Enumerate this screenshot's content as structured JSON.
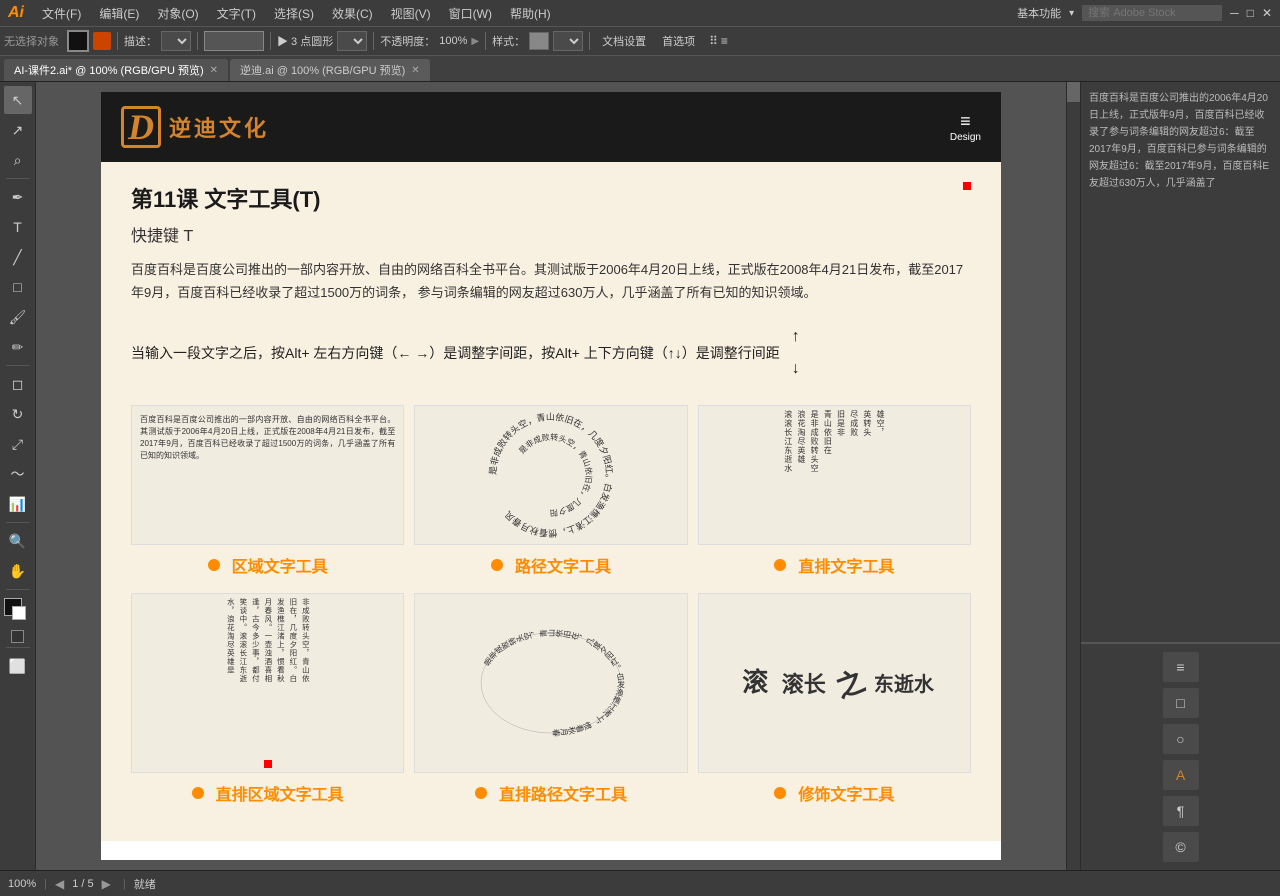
{
  "app": {
    "logo": "Ai",
    "menus": [
      "文件(F)",
      "编辑(E)",
      "对象(O)",
      "文字(T)",
      "选择(S)",
      "效果(C)",
      "视图(V)",
      "窗口(W)",
      "帮助(H)"
    ],
    "workspace": "基本功能",
    "search_placeholder": "搜索 Adobe Stock"
  },
  "toolbar": {
    "no_selection": "无选择对象",
    "description_label": "描述：",
    "points_label": "▶ 3 点圆形",
    "opacity_label": "不透明度：",
    "opacity_value": "100%",
    "style_label": "样式：",
    "doc_settings": "文档设置",
    "preferences": "首选项"
  },
  "tabs": [
    {
      "label": "AI-课件2.ai* @ 100% (RGB/GPU 预览)",
      "active": true
    },
    {
      "label": "逆迪.ai @ 100% (RGB/GPU 预览)",
      "active": false
    }
  ],
  "document": {
    "header": {
      "logo_icon": "D",
      "logo_text": "逆迪文化",
      "menu_label": "Design"
    },
    "lesson": {
      "title": "第11课   文字工具(T)",
      "shortcut": "快捷键 T",
      "description": "百度百科是百度公司推出的一部内容开放、自由的网络百科全书平台。其测试版于2006年4月20日上线，正式版在2008年4月21日发布，截至2017年9月，百度百科已经收录了超过1500万的词条，\n参与词条编辑的网友超过630万人，几乎涵盖了所有已知的知识领域。",
      "tip": "当输入一段文字之后，按Alt+ 左右方向键（← →）是调整字间距，按Alt+ 上下方向键（↑↓）是调整行间距"
    },
    "tools": [
      {
        "name": "区域文字工具",
        "demo_text": "百度百科是百度公司推出的一部内容开放、自由的网络百科全书平台。其测试版于2006年4月20日上线，正式版在2008年4月21日发布，截至2017年9月，百度百科已经收录了超过1500万的词条，几乎涵盖了所有已知的知识领域。"
      },
      {
        "name": "路径文字工具",
        "demo_text": "是非成败转头空，青山依旧在，几度夕阳红。白发渔樵江渚上，惯看秋月春风。"
      },
      {
        "name": "直排文字工具",
        "demo_text": "滚滚长江东逝水，浪花淘尽英雄。是非成败转头空，青山依旧在"
      }
    ],
    "tools_bottom": [
      {
        "name": "直排区域文字工具"
      },
      {
        "name": "直排路径文字工具"
      },
      {
        "name": "修饰文字工具"
      }
    ]
  },
  "right_panel": {
    "text": "百度百科是百度公司推出的2006年4月20日上线，正式版年9月，百度百科已经收录了参与词条编辑的网友超过6：截至2017年9月，百度百科已参与词条编辑的网友超过6：截至2017年9月，百度百科E友超过630万人，几乎涵盖了"
  },
  "status_bar": {
    "zoom": "100%",
    "page_info": "1 / 5",
    "status": "就绪"
  },
  "colors": {
    "orange": "#d4842a",
    "black": "#1a1a1a",
    "panel_bg": "#3c3c3c",
    "canvas_bg": "#535353",
    "doc_bg": "#f8f0e0"
  }
}
